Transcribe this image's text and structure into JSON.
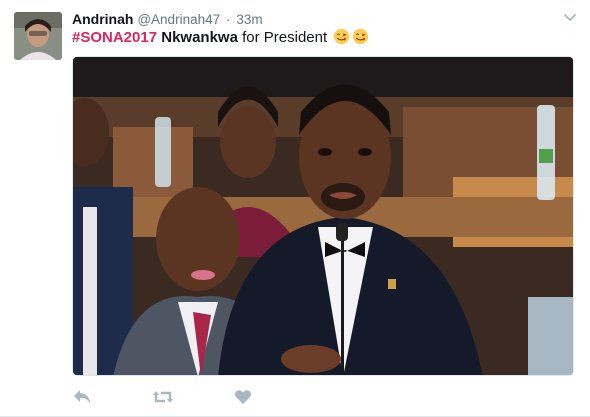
{
  "tweet": {
    "display_name": "Andrinah",
    "handle": "@Andrinah47",
    "separator": "·",
    "time": "33m",
    "hashtag": "#SONA2017",
    "mention": "Nkwankwa",
    "text_rest": " for President",
    "emojis": [
      "face-savoring-food-emoji",
      "face-savoring-food-emoji"
    ]
  },
  "media": {
    "description_icon": "photo"
  },
  "actions": {
    "reply_icon": "reply-icon",
    "retweet_icon": "retweet-icon",
    "like_icon": "heart-icon"
  },
  "colors": {
    "hashtag": "#e0245e",
    "muted": "#657786",
    "action_icon": "#aab8c2"
  }
}
